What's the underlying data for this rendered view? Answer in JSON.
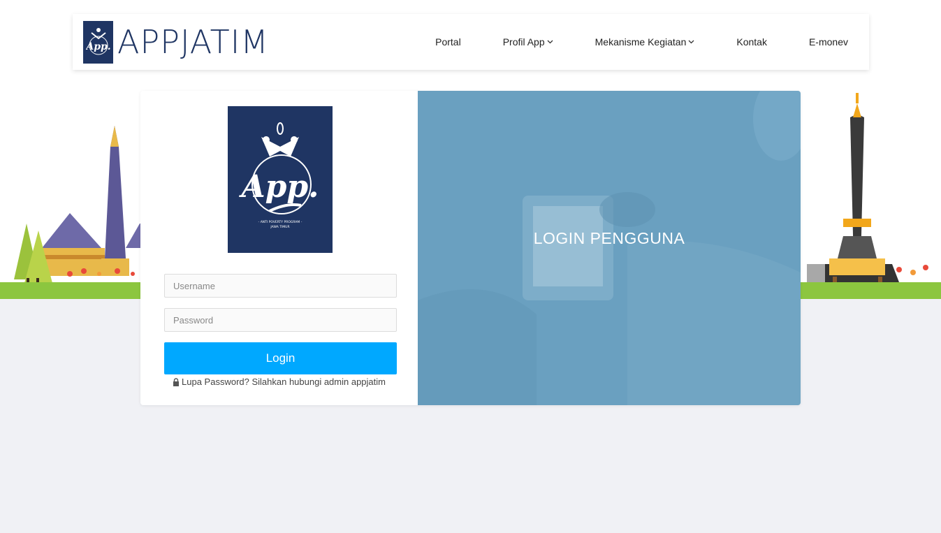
{
  "brand": {
    "title": "APPJATIM",
    "logo_icon": "app-logo-icon"
  },
  "nav": {
    "items": [
      {
        "label": "Portal",
        "has_dropdown": false
      },
      {
        "label": "Profil App",
        "has_dropdown": true
      },
      {
        "label": "Mekanisme Kegiatan",
        "has_dropdown": true
      },
      {
        "label": "Kontak",
        "has_dropdown": false
      },
      {
        "label": "E-monev",
        "has_dropdown": false
      }
    ]
  },
  "login": {
    "logo": {
      "script_text": "App.",
      "small_line1": "- ANTI POVERTY PROGRAM -",
      "small_line2": "JAWA TIMUR"
    },
    "username_placeholder": "Username",
    "password_placeholder": "Password",
    "button_label": "Login",
    "forgot_text": "Lupa Password? Silahkan hubungi admin appjatim",
    "forgot_icon": "lock-icon"
  },
  "panel": {
    "title": "LOGIN PENGGUNA"
  },
  "colors": {
    "brand_navy": "#1f3563",
    "button_blue": "#00a8ff",
    "panel_blue": "#6aa0c0",
    "grass_green": "#8cc63f",
    "page_bg": "#f0f1f5"
  }
}
